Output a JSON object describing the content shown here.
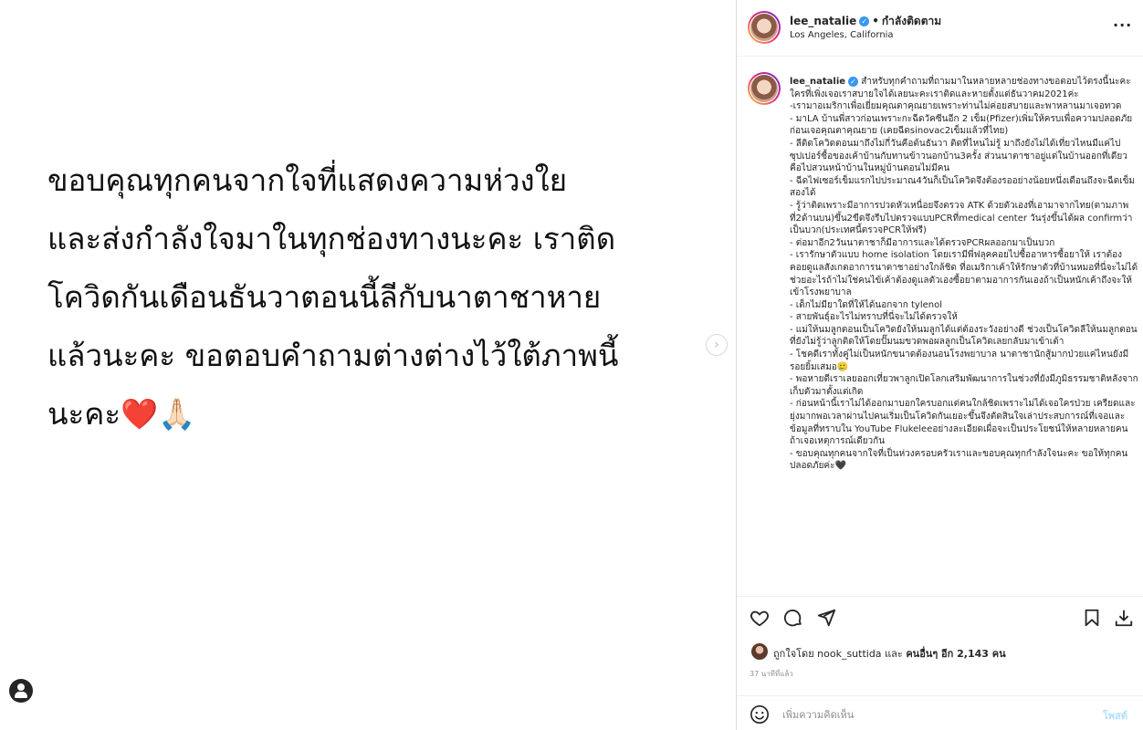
{
  "media": {
    "lines": [
      "ขอบคุณทุกคนจากใจที่แสดงความห่วงใย",
      "และส่งกำลังใจมาในทุกช่องทางนะคะ เราติด",
      "โควิดกันเดือนธันวาตอนนี้ลีกับนาตาชาหาย",
      "แล้วนะคะ ขอตอบคำถามต่างต่างไว้ใต้ภาพนี้",
      "นะคะ❤️🙏🏻"
    ],
    "next_arrow": "›",
    "cutoff_text": "…"
  },
  "header": {
    "username": "lee_natalie",
    "verified_mark": "✓",
    "separator": "•",
    "follow_status": "กำลังติดตาม",
    "location": "Los Angeles, California",
    "more": "···"
  },
  "caption": {
    "username": "lee_natalie",
    "verified_mark": "✓",
    "lines": [
      "สำหรับทุกคำถามที่ถามมาในหลายหลายช่องทางขอตอบไว้ตรงนี้นะคะ ใครที่เพิ่งเจอเราสบายใจได้เลยนะคะเราติดและหายตั้งแต่ธันวาคม2021ค่ะ",
      "-เรามาอเมริกาเพื่อเยี่ยมคุณตาคุณยายเพราะท่านไม่ค่อยสบายและพาหลานมาเจอทวด",
      "- มาLA บ้านพี่สาวก่อนเพราะกะฉีดวัคซีนอีก 2 เข็ม(Pfizer)เพิ่มให้ครบเพื่อความปลอดภัยก่อนเจอคุณตาคุณยาย (เคยฉีดsinovac2เข็มแล้วที่ไทย)",
      "- ลีติดโควิดตอนมาถึงไม่กี่วันคือต้นธันวา ติดที่ไหนไม่รู้ มาถึงยังไม่ได้เที่ยวไหนมีแค่ไปซุปเปอร์ซื้อของเค้าบ้านกับทานข้าวนอกบ้าน3ครั้ง ส่วนนาตาชาอยู่แต่ในบ้านออกที่เดียวคือไปสวนหน้าบ้านในหมู่บ้านตอนไม่มีคน",
      "- ฉีดไฟเซอร์เข็มแรกไปประมาณ4วันก็เป็นโควิดจึงต้องรออย่างน้อยหนึ่งเดือนถึงจะฉีดเข็มสองได้",
      "- รู้ว่าติดเพราะมีอาการปวดหัวเหนื่อยจึงตรวจ ATK ด้วยตัวเองที่เอามาจากไทย(ตามภาพที่2ด้านบน)ขึ้น2ขีดจึงรีบไปตรวจแบบPCRที่medical center วันรุ่งขึ้นได้ผล confirmว่าเป็นบวก(ประเทศนี้ตรวจPCRให้ฟรี)",
      "- ต่อมาอีก2วันนาตาชาก็มีอาการและได้ตรวจPCRผลออกมาเป็นบวก",
      "- เรารักษาตัวแบบ home isolation โดยเรามีพี่ฟลุคคอยไปซื้ออาหารซื้อยาให้ เราต้องคอยดูแลสังเกตอาการนาตาชาอย่างใกล้ชิด ที่อเมริกาเค้าให้รักษาตัวที่บ้านหมอที่นี่จะไม่ได้ช่วยอะไรถ้าไม่ใช่คนไข้เค้าต้องดูแลตัวเองซื้อยาตามอาการกันเองถ้าเป็นหนักเค้าถึงจะให้เข้าโรงพยาบาล",
      "- เด็กไม่มียาใดที่ให้ได้นอกจาก tylenol",
      "- สายพันธุ์อะไรไม่ทราบที่นี่จะไม่ได้ตรวจให้",
      "- แม่ให้นมลูกตอนเป็นโควิดยังให้นมลูกได้แต่ต้องระวังอย่างดี ช่วงเป็นโควิดลีให้นมลูกตอนที่ยังไม่รู้ว่าลูกติดให้โดยปั๊มนมขวดพอผลลูกเป็นโควิดเลยกลับมาเข้าเต้า",
      "- โชคดีเราทั้งคู่ไม่เป็นหนักขนาดต้องนอนโรงพยาบาล นาตาชานักสู้มากป่วยแค่ไหนยังมีรอยยิ้มเสมอ🥲",
      "- พอหายดีเราเลยออกเที่ยวพาลูกเปิดโลกเสริมพัฒนาการในช่วงที่ยังมีภูมิธรรมชาติหลังจากเก็บตัวมาตั้งแต่เกิด",
      "- ก่อนหน้านี้เราไม่ได้ออกมาบอกใครบอกแต่คนใกล้ชิดเพราะไม่ได้เจอใครป่วย เครียดและยุ่งมากพอเวลาผ่านไปคนเริ่มเป็นโควิดกันเยอะขึ้นจึงตัดสินใจเล่าประสบการณ์ที่เจอและข้อมูลที่ทราบใน YouTube Flukeleeอย่างละเอียดเผื่อจะเป็นประโยชน์ให้หลายหลายคนถ้าเจอเหตุการณ์เดียวกัน",
      "- ขอบคุณทุกคนจากใจที่เป็นห่วงครอบครัวเราและขอบคุณทุกกำลังใจนะคะ ขอให้ทุกคนปลอดภัยค่ะ🖤"
    ]
  },
  "likes": {
    "prefix": "ถูกใจโดย",
    "liker": "nook_suttida",
    "conj": "และ",
    "others": "คนอื่นๆ อีก 2,143 คน"
  },
  "timeago": "37 นาทีที่แล้ว",
  "comment": {
    "placeholder": "เพิ่มความคิดเห็น",
    "post_label": "โพสต์"
  }
}
